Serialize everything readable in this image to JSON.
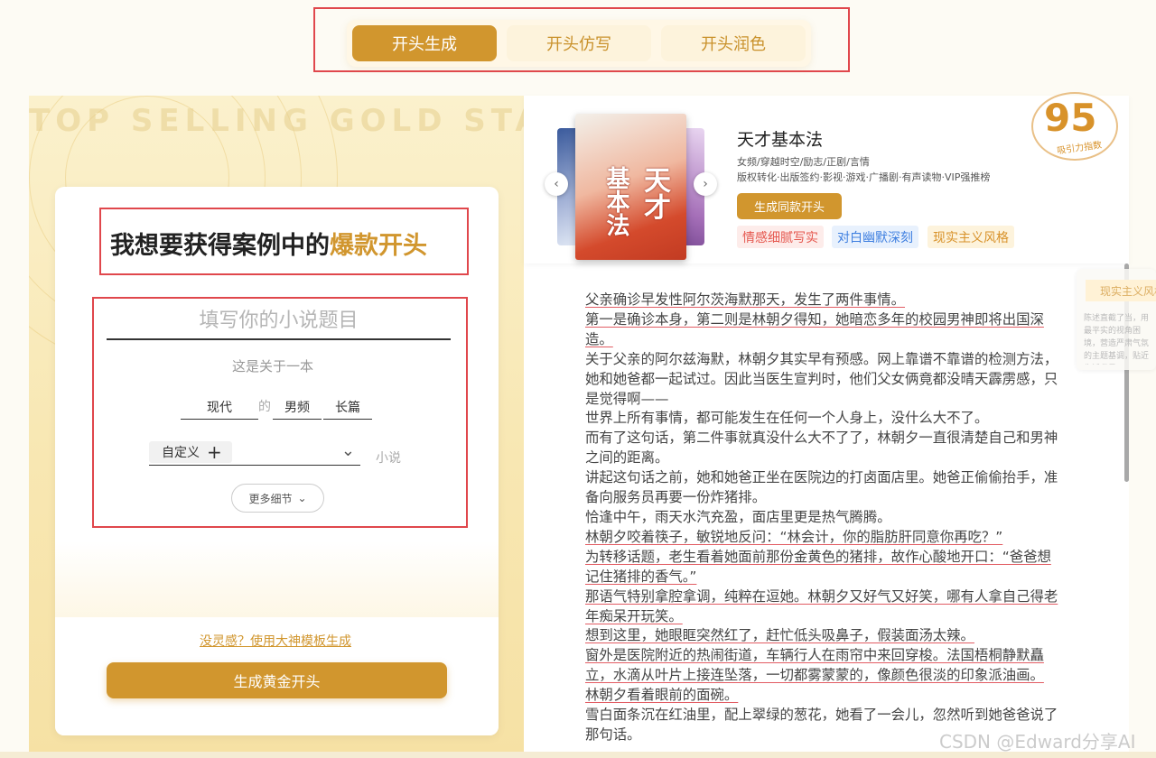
{
  "tabs": [
    {
      "label": "开头生成",
      "active": true
    },
    {
      "label": "开头仿写",
      "active": false
    },
    {
      "label": "开头润色",
      "active": false
    }
  ],
  "left": {
    "bg_text": "TOP SELLING GOLD START",
    "headline_prefix": "我想要获得案例中的",
    "headline_highlight": "爆款开头",
    "title_placeholder": "填写你的小说题目",
    "sub_label": "这是关于一本",
    "era": "现代",
    "de": "的",
    "channel": "男频",
    "length": "长篇",
    "custom_label": "自定义",
    "novel_suffix": "小说",
    "more_details": "更多细节",
    "template_link": "没灵感？使用大神模板生成",
    "generate_button": "生成黄金开头"
  },
  "book": {
    "title": "天才基本法",
    "cover_title_1": "天才",
    "cover_title_2": "基本法",
    "meta_1": "女频/穿越时空/励志/正剧/言情",
    "meta_2": "版权转化·出版签约·影视·游戏·广播剧·有声读物·VIP强推榜",
    "same_button": "生成同款开头",
    "tags": [
      "情感细腻写实",
      "对白幽默深刻",
      "现实主义风格"
    ],
    "score": "95",
    "score_label": "吸引力指数"
  },
  "story": [
    {
      "text": "父亲确诊早发性阿尔茨海默那天，发生了两件事情。",
      "u": true
    },
    {
      "text": "第一是确诊本身，第二则是林朝夕得知，她暗恋多年的校园男神即将出国深造。",
      "u": true
    },
    {
      "text": "关于父亲的阿尔兹海默，林朝夕其实早有预感。网上靠谱不靠谱的检测方法，她和她爸都一起试过。因此当医生宣判时，他们父女俩竟都没晴天霹雳感，只是觉得啊——",
      "u": false
    },
    {
      "text": "世界上所有事情，都可能发生在任何一个人身上，没什么大不了。",
      "u": false
    },
    {
      "text": "而有了这句话，第二件事就真没什么大不了了，林朝夕一直很清楚自己和男神之间的距离。",
      "u": false
    },
    {
      "text": "讲起这句话之前，她和她爸正坐在医院边的打卤面店里。她爸正偷偷抬手，准备向服务员再要一份炸猪排。",
      "u": false
    },
    {
      "text": "恰逢中午，雨天水汽充盈，面店里更是热气腾腾。",
      "u": false
    },
    {
      "text": "林朝夕咬着筷子，敏锐地反问：“林会计，你的脂肪肝同意你再吃？”",
      "u": true
    },
    {
      "text": "为转移话题，老生看着她面前那份金黄色的猪排，故作心酸地开口：“爸爸想记住猪排的香气。”",
      "u": true
    },
    {
      "text": "那语气特别拿腔拿调，纯粹在逗她。林朝夕又好气又好笑，哪有人拿自己得老年痴呆开玩笑。",
      "u": true
    },
    {
      "text": "想到这里，她眼眶突然红了，赶忙低头吸鼻子，假装面汤太辣。",
      "u": true
    },
    {
      "text": "窗外是医院附近的热闹街道，车辆行人在雨帘中来回穿梭。法国梧桐静默矗立，水滴从叶片上接连坠落，一切都雾蒙蒙的，像颜色很淡的印象派油画。",
      "u": true
    },
    {
      "text": "林朝夕看着眼前的面碗。",
      "u": true
    },
    {
      "text": "雪白面条沉在红油里，配上翠绿的葱花，她看了一会儿，忽然听到她爸爸说了那句话。",
      "u": false
    }
  ],
  "peek": {
    "tag": "现实主义风格",
    "text": "陈述直截了当，用最平实的视角困境，营造严肃气氛的主题基调，贴近生活背景。"
  },
  "watermark": "CSDN @Edward分享AI"
}
